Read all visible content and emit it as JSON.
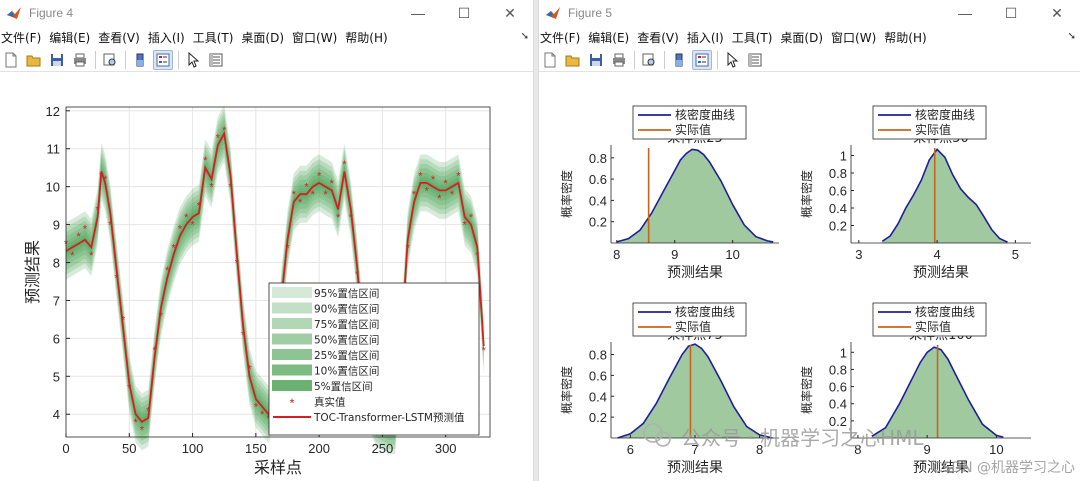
{
  "window1": {
    "title": "Figure 4",
    "menu": [
      "文件(F)",
      "编辑(E)",
      "查看(V)",
      "插入(I)",
      "工具(T)",
      "桌面(D)",
      "窗口(W)",
      "帮助(H)"
    ]
  },
  "window2": {
    "title": "Figure 5",
    "menu": [
      "文件(F)",
      "编辑(E)",
      "查看(V)",
      "插入(I)",
      "工具(T)",
      "桌面(D)",
      "窗口(W)",
      "帮助(H)"
    ]
  },
  "toolbar_icons": [
    "new-file-icon",
    "open-folder-icon",
    "save-icon",
    "print-icon",
    "print-preview-icon",
    "colorbar-icon",
    "legend-icon",
    "pointer-icon",
    "property-inspector-icon"
  ],
  "colors": {
    "band": "#3d9a46",
    "prediction": "#d42020",
    "truth": "#d42020",
    "kde_line": "#1f1f9e",
    "kde_fill": "#8fbf8f",
    "actual": "#c8641e"
  },
  "chart_data": [
    {
      "type": "line",
      "xlabel": "采样点",
      "ylabel": "预测结果",
      "xlim": [
        0,
        335
      ],
      "ylim": [
        3.4,
        12.1
      ],
      "xticks": [
        0,
        50,
        100,
        150,
        200,
        250,
        300
      ],
      "yticks": [
        4,
        5,
        6,
        7,
        8,
        9,
        10,
        11,
        12
      ],
      "grid": true,
      "legend_position": "bottom-right",
      "legend": [
        "95%置信区间",
        "90%置信区间",
        "75%置信区间",
        "50%置信区间",
        "25%置信区间",
        "10%置信区间",
        "5%置信区间",
        "真实值",
        "TOC-Transformer-LSTM预测值"
      ],
      "band_widths": [
        0.75,
        0.62,
        0.5,
        0.38,
        0.26,
        0.16,
        0.08
      ],
      "prediction": {
        "x": [
          0,
          5,
          10,
          15,
          20,
          25,
          28,
          31,
          35,
          40,
          45,
          50,
          55,
          60,
          65,
          70,
          75,
          80,
          85,
          90,
          95,
          100,
          105,
          110,
          115,
          120,
          125,
          130,
          135,
          140,
          145,
          150,
          155,
          160,
          165,
          170,
          175,
          180,
          185,
          190,
          195,
          200,
          205,
          210,
          215,
          220,
          225,
          230,
          235,
          240,
          245,
          250,
          255,
          260,
          265,
          270,
          275,
          280,
          285,
          290,
          295,
          300,
          305,
          310,
          315,
          320,
          325,
          330
        ],
        "y": [
          8.3,
          8.4,
          8.5,
          8.6,
          8.4,
          9.2,
          10.4,
          10.1,
          9.3,
          7.8,
          6.3,
          4.8,
          4.0,
          3.8,
          3.9,
          5.5,
          6.8,
          7.6,
          8.2,
          8.7,
          9.0,
          9.2,
          9.3,
          10.5,
          10.2,
          11.1,
          11.4,
          10.3,
          8.2,
          6.3,
          5.0,
          4.4,
          4.2,
          4.0,
          4.5,
          7.0,
          8.6,
          9.6,
          9.8,
          9.8,
          10.0,
          10.1,
          10.0,
          9.9,
          9.4,
          10.4,
          9.4,
          7.9,
          5.9,
          4.3,
          3.9,
          3.8,
          3.7,
          3.7,
          6.0,
          8.6,
          9.6,
          10.1,
          10.1,
          10.0,
          9.9,
          9.9,
          10.0,
          10.1,
          9.2,
          9.0,
          8.4,
          5.8
        ]
      },
      "truth": {
        "x": [
          0,
          5,
          10,
          15,
          20,
          25,
          28,
          31,
          35,
          40,
          45,
          50,
          55,
          60,
          65,
          70,
          75,
          80,
          85,
          90,
          95,
          100,
          105,
          110,
          115,
          120,
          125,
          130,
          135,
          140,
          145,
          150,
          155,
          160,
          165,
          170,
          175,
          180,
          185,
          190,
          195,
          200,
          205,
          210,
          215,
          220,
          225,
          230,
          235,
          240,
          245,
          250,
          255,
          260,
          265,
          270,
          275,
          280,
          285,
          290,
          295,
          300,
          305,
          310,
          315,
          320,
          325,
          330
        ],
        "y": [
          8.5,
          8.2,
          8.7,
          8.9,
          8.2,
          9.4,
          10.3,
          10.2,
          9.0,
          7.6,
          6.5,
          4.7,
          3.8,
          3.6,
          4.1,
          5.7,
          6.6,
          7.8,
          8.4,
          8.9,
          9.2,
          9.0,
          9.5,
          10.7,
          10.0,
          11.3,
          11.5,
          10.0,
          8.0,
          6.1,
          5.2,
          4.2,
          4.0,
          3.9,
          4.7,
          7.2,
          8.4,
          9.8,
          9.6,
          10.0,
          9.8,
          10.3,
          9.8,
          10.1,
          9.2,
          10.6,
          9.2,
          7.7,
          5.7,
          4.1,
          3.7,
          3.6,
          3.8,
          3.8,
          6.2,
          8.4,
          9.8,
          10.3,
          9.9,
          10.2,
          9.7,
          10.1,
          9.8,
          10.3,
          9.0,
          9.2,
          8.2,
          5.7
        ]
      }
    },
    {
      "type": "area",
      "subplots": [
        {
          "title": "采样点25",
          "xlabel": "预测结果",
          "ylabel": "概率密度",
          "xlim": [
            7.9,
            10.8
          ],
          "ylim": [
            0,
            0.92
          ],
          "xticks": [
            8,
            9,
            10
          ],
          "yticks": [
            0.2,
            0.4,
            0.6,
            0.8
          ],
          "legend": [
            "核密度曲线",
            "实际值"
          ],
          "actual": 8.55,
          "kde": {
            "x": [
              8.0,
              8.2,
              8.4,
              8.6,
              8.8,
              9.0,
              9.1,
              9.2,
              9.3,
              9.4,
              9.5,
              9.6,
              9.8,
              10.0,
              10.2,
              10.4,
              10.6,
              10.7
            ],
            "y": [
              0.01,
              0.04,
              0.12,
              0.28,
              0.48,
              0.68,
              0.78,
              0.84,
              0.88,
              0.87,
              0.83,
              0.76,
              0.58,
              0.36,
              0.17,
              0.06,
              0.02,
              0.01
            ]
          }
        },
        {
          "title": "采样点50",
          "xlabel": "预测结果",
          "ylabel": "概率密度",
          "xlim": [
            2.9,
            5.2
          ],
          "ylim": [
            0,
            1.12
          ],
          "xticks": [
            3,
            4,
            5
          ],
          "yticks": [
            0.2,
            0.4,
            0.6,
            0.8,
            1
          ],
          "legend": [
            "核密度曲线",
            "实际值"
          ],
          "actual": 3.97,
          "kde": {
            "x": [
              3.3,
              3.4,
              3.5,
              3.6,
              3.7,
              3.8,
              3.9,
              4.0,
              4.1,
              4.2,
              4.3,
              4.4,
              4.5,
              4.6,
              4.7,
              4.8,
              4.9
            ],
            "y": [
              0.02,
              0.08,
              0.22,
              0.4,
              0.55,
              0.72,
              0.95,
              1.07,
              0.98,
              0.78,
              0.62,
              0.52,
              0.44,
              0.3,
              0.15,
              0.05,
              0.01
            ]
          }
        },
        {
          "title": "采样点75",
          "xlabel": "预测结果",
          "ylabel": "概率密度",
          "xlim": [
            5.7,
            8.3
          ],
          "ylim": [
            0,
            0.92
          ],
          "xticks": [
            6,
            7,
            8
          ],
          "yticks": [
            0.2,
            0.4,
            0.6,
            0.8
          ],
          "legend": [
            "核密度曲线",
            "实际值"
          ],
          "actual": 6.93,
          "kde": {
            "x": [
              5.8,
              6.0,
              6.2,
              6.4,
              6.6,
              6.8,
              6.9,
              7.0,
              7.1,
              7.2,
              7.4,
              7.6,
              7.8,
              8.0,
              8.2
            ],
            "y": [
              0.0,
              0.04,
              0.14,
              0.33,
              0.57,
              0.8,
              0.88,
              0.9,
              0.86,
              0.78,
              0.55,
              0.3,
              0.11,
              0.03,
              0.0
            ]
          }
        },
        {
          "title": "采样点100",
          "xlabel": "预测结果",
          "ylabel": "概率密度",
          "xlim": [
            7.9,
            10.5
          ],
          "ylim": [
            0,
            1.12
          ],
          "xticks": [
            8,
            9,
            10
          ],
          "yticks": [
            0.2,
            0.4,
            0.6,
            0.8,
            1
          ],
          "legend": [
            "核密度曲线",
            "实际值"
          ],
          "actual": 9.15,
          "kde": {
            "x": [
              8.2,
              8.4,
              8.6,
              8.8,
              8.9,
              9.0,
              9.1,
              9.2,
              9.3,
              9.4,
              9.6,
              9.8,
              10.0,
              10.1
            ],
            "y": [
              0.02,
              0.12,
              0.4,
              0.72,
              0.88,
              1.0,
              1.06,
              1.03,
              0.92,
              0.76,
              0.44,
              0.16,
              0.03,
              0.01
            ]
          }
        }
      ]
    }
  ],
  "watermark": {
    "wechat_label": "公众号 · 机器学习之心HML",
    "csdn_label": "CSDN @机器学习之心"
  }
}
